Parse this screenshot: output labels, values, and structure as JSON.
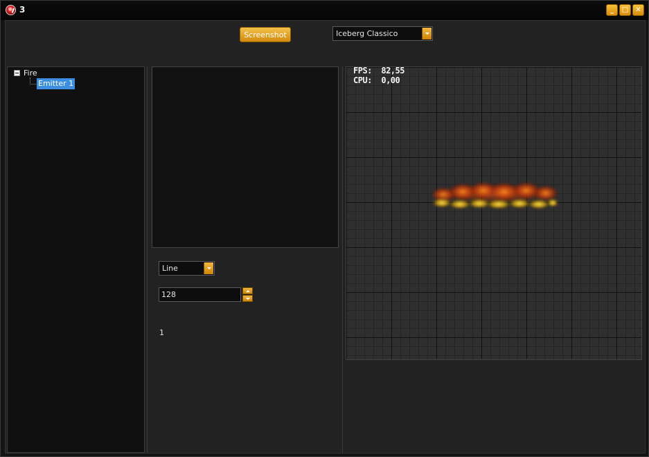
{
  "window": {
    "title": "3",
    "controls": {
      "minimize": "_",
      "maximize": "□",
      "close": "✕"
    }
  },
  "toolbar": {
    "screenshot_label": "Screenshot",
    "skin_select": {
      "value": "Iceberg Classico"
    }
  },
  "tree": {
    "root_label": "Fire",
    "children": [
      {
        "label": "Emitter 1",
        "selected": true
      }
    ]
  },
  "emitter": {
    "shape_select": {
      "value": "Line"
    },
    "count_spinbox": {
      "value": "128"
    },
    "value_label": "1"
  },
  "viewport": {
    "fps_label": "FPS:",
    "fps_value": "82,55",
    "cpu_label": "CPU:",
    "cpu_value": "0,00"
  },
  "icons": {
    "app": "app-logo-icon",
    "tree_toggle": "collapse-minus-icon",
    "dropdown": "chevron-down-icon",
    "spin_up": "arrow-up-icon",
    "spin_down": "arrow-down-icon"
  },
  "colors": {
    "accent": "#e0a020",
    "selection": "#3c8fe0",
    "background": "#222222"
  }
}
